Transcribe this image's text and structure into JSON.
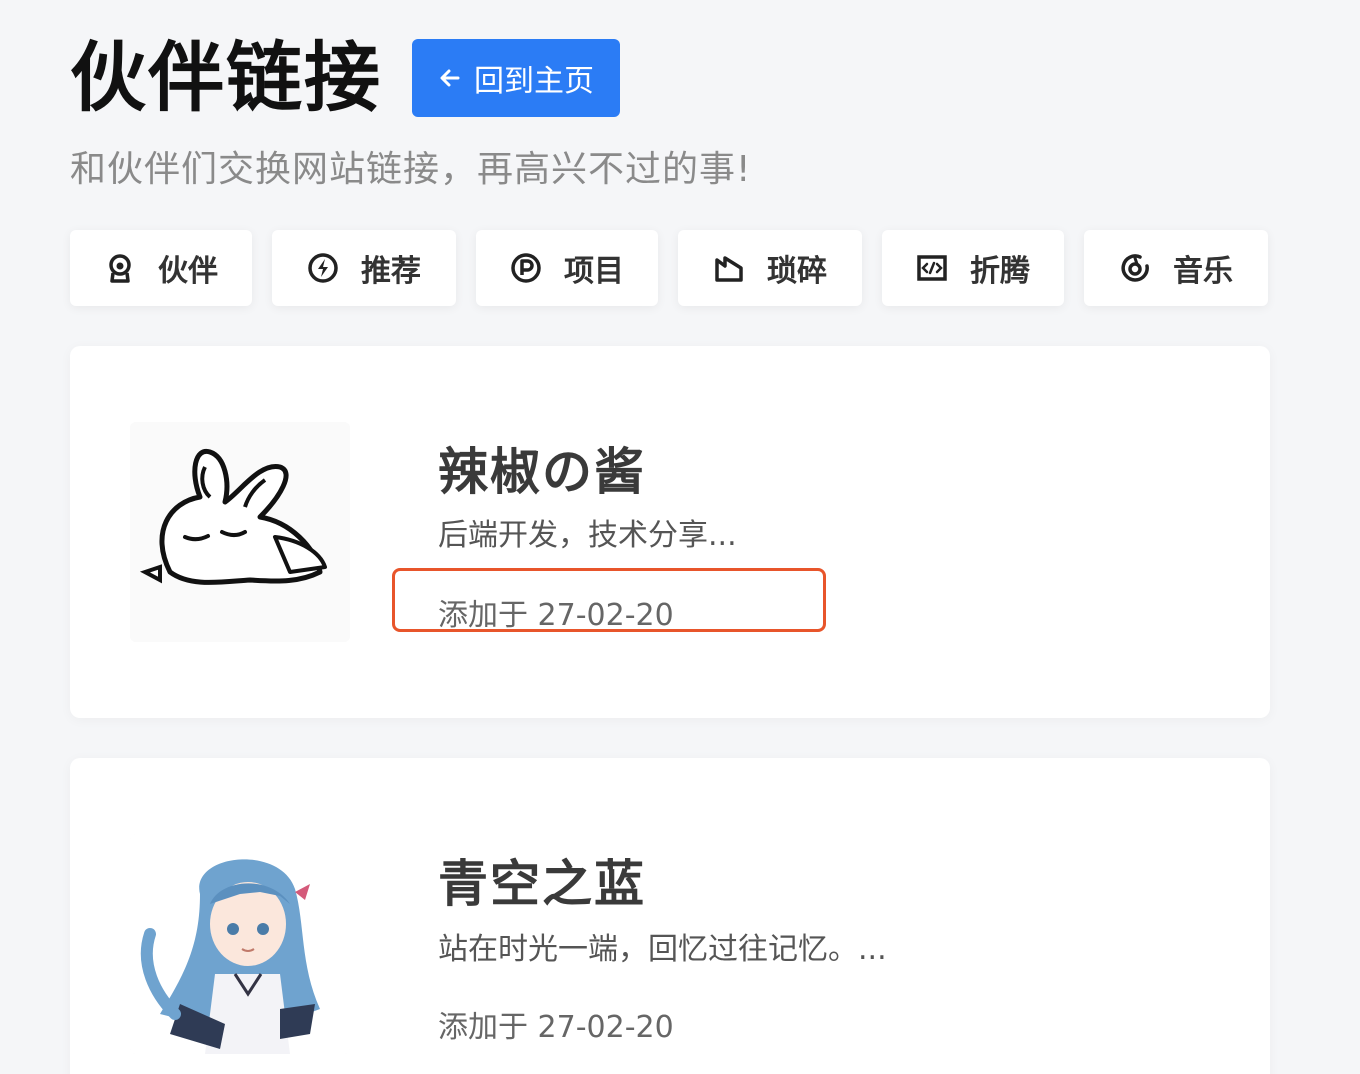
{
  "header": {
    "title": "伙伴链接",
    "home_button": "回到主页",
    "subtitle": "和伙伴们交换网站链接，再高兴不过的事!"
  },
  "tabs": [
    {
      "label": "伙伴",
      "icon": "partner-icon"
    },
    {
      "label": "推荐",
      "icon": "bolt-icon"
    },
    {
      "label": "项目",
      "icon": "project-icon"
    },
    {
      "label": "琐碎",
      "icon": "trivia-icon"
    },
    {
      "label": "折腾",
      "icon": "code-icon"
    },
    {
      "label": "音乐",
      "icon": "music-icon"
    }
  ],
  "friends": [
    {
      "name": "辣椒の酱",
      "description": "后端开发，技术分享...",
      "date": "添加于 27-02-20",
      "avatar": "rabbit-avatar"
    },
    {
      "name": "青空之蓝",
      "description": "站在时光一端，回忆过往记忆。...",
      "date": "添加于 27-02-20",
      "avatar": "anime-girl-avatar"
    }
  ],
  "colors": {
    "accent": "#2b7cf5",
    "highlight": "#e8552b"
  }
}
